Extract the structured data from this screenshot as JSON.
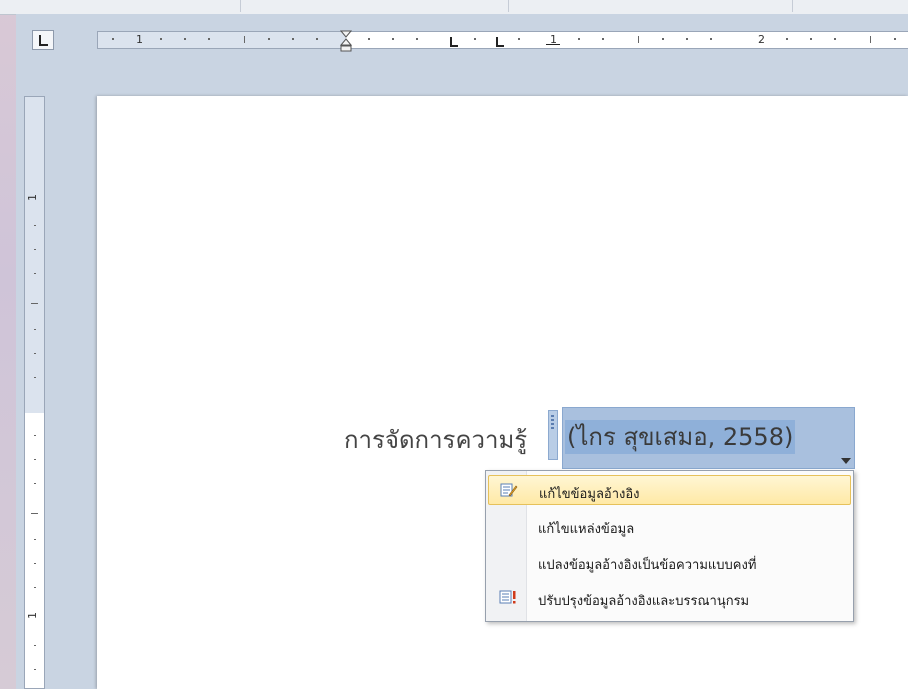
{
  "ruler": {
    "h_numbers": [
      "1",
      "1",
      "2"
    ],
    "v_numbers": [
      "1",
      "1"
    ]
  },
  "document": {
    "text": "การจัดการความรู้",
    "citation": "(ไกร สุขเสมอ, 2558)"
  },
  "citation_menu": {
    "items": [
      {
        "label": "แก้ไขข้อมูลอ้างอิง",
        "icon": "edit-citation-icon",
        "highlighted": true
      },
      {
        "label": "แก้ไขแหล่งข้อมูล",
        "icon": null,
        "highlighted": false
      },
      {
        "label": "แปลงข้อมูลอ้างอิงเป็นข้อความแบบคงที่",
        "icon": null,
        "highlighted": false
      },
      {
        "label": "ปรับปรุงข้อมูลอ้างอิงและบรรณานุกรม",
        "icon": "update-bibliography-icon",
        "highlighted": false
      }
    ]
  },
  "colors": {
    "citation_fill": "#a9c0de",
    "menu_highlight": "#ffe9a6"
  }
}
